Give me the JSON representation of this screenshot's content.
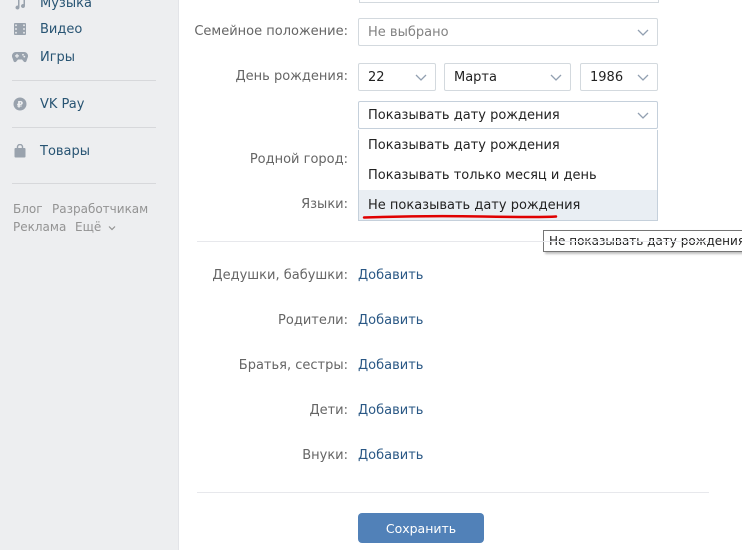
{
  "sidebar": {
    "items": [
      {
        "label": "Музыка",
        "icon": "music-note-icon"
      },
      {
        "label": "Видео",
        "icon": "film-icon"
      },
      {
        "label": "Игры",
        "icon": "gamepad-icon"
      },
      {
        "label": "VK Pay",
        "icon": "ruble-coin-icon"
      },
      {
        "label": "Товары",
        "icon": "shopping-bag-icon"
      }
    ],
    "footer": {
      "blog": "Блог",
      "developers": "Разработчикам",
      "ads": "Реклама",
      "more": "Ещё"
    }
  },
  "form": {
    "marital_label": "Семейное положение:",
    "marital_value": "Не выбрано",
    "birthday_label": "День рождения:",
    "birthday_day": "22",
    "birthday_month": "Марта",
    "birthday_year": "1986",
    "birthday_visibility": "Показывать дату рождения",
    "hometown_label": "Родной город:",
    "languages_label": "Языки:",
    "visibility_options": [
      "Показывать дату рождения",
      "Показывать только месяц и день",
      "Не показывать дату рождения"
    ],
    "tooltip": "Не показывать дату рождения",
    "relatives": [
      {
        "label": "Дедушки, бабушки:",
        "action": "Добавить"
      },
      {
        "label": "Родители:",
        "action": "Добавить"
      },
      {
        "label": "Братья, сестры:",
        "action": "Добавить"
      },
      {
        "label": "Дети:",
        "action": "Добавить"
      },
      {
        "label": "Внуки:",
        "action": "Добавить"
      }
    ],
    "save_label": "Сохранить"
  },
  "colors": {
    "link": "#2a5885",
    "button": "#5181b8",
    "highlight": "#e9eef3",
    "annotation": "#e00000"
  }
}
